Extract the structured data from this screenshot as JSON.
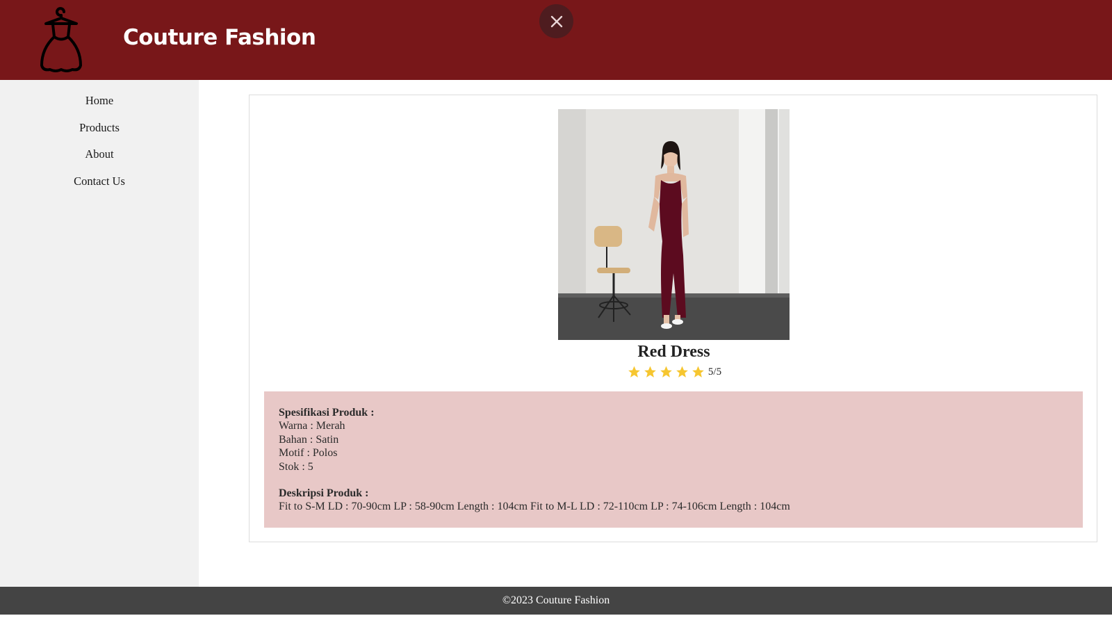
{
  "header": {
    "brand": "Couture Fashion",
    "logo_icon": "dress-icon",
    "close_icon": "close-icon",
    "colors": {
      "background": "#781719",
      "close_button": "#4e1c1f"
    }
  },
  "sidebar": {
    "items": [
      {
        "label": "Home"
      },
      {
        "label": "Products"
      },
      {
        "label": "About"
      },
      {
        "label": "Contact Us"
      }
    ]
  },
  "product": {
    "title": "Red Dress",
    "rating": {
      "value": 5,
      "max": 5,
      "label": "5/5",
      "star_color": "#f6c630"
    },
    "specs": {
      "heading": "Spesifikasi Produk :",
      "lines": [
        "Warna : Merah",
        "Bahan : Satin",
        "Motif : Polos",
        "Stok : 5"
      ]
    },
    "description": {
      "heading": "Deskripsi Produk :",
      "text": "Fit to S-M LD : 70-90cm LP : 58-90cm Length : 104cm Fit to M-L LD : 72-110cm LP : 74-106cm Length : 104cm"
    }
  },
  "footer": {
    "text": "©2023 Couture Fashion"
  }
}
